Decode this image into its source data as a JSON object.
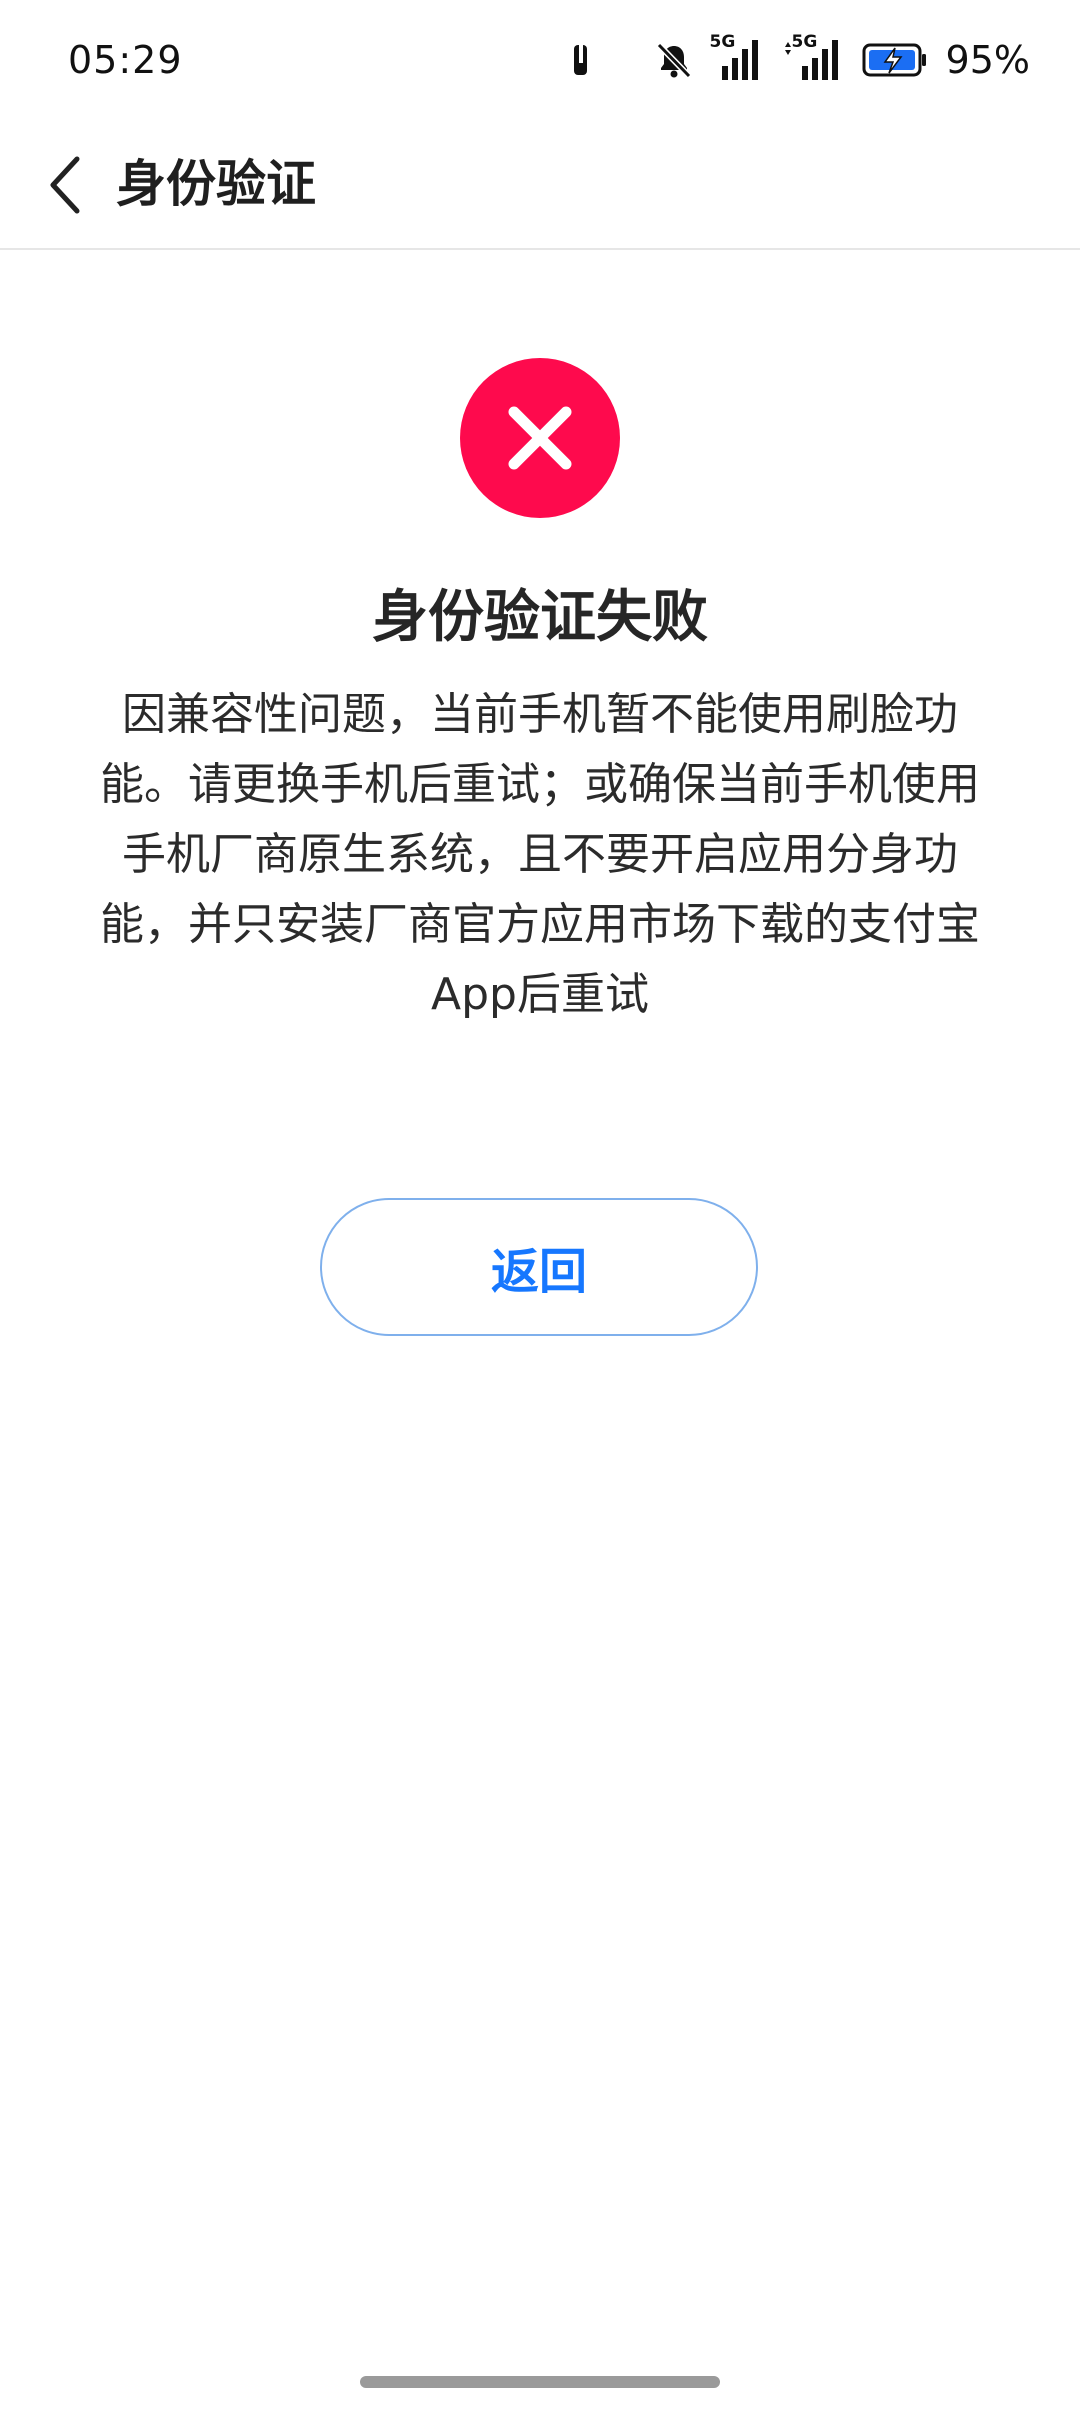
{
  "status_bar": {
    "time": "05:29",
    "network_1": "5G",
    "network_2": "5G",
    "battery_percent": "95%",
    "icons": [
      "notification-icon",
      "mute-icon",
      "signal-5g-icon",
      "signal-5g-icon",
      "battery-charging-icon"
    ]
  },
  "header": {
    "title": "身份验证",
    "back_icon": "chevron-left-icon"
  },
  "result": {
    "icon": "error-x-icon",
    "icon_color": "#fe0a4d",
    "title": "身份验证失败",
    "message": "因兼容性问题，当前手机暂不能使用刷脸功能。请更换手机后重试；或确保当前手机使用手机厂商原生系统，且不要开启应用分身功能，并只安装厂商官方应用市场下载的支付宝App后重试"
  },
  "actions": {
    "return_label": "返回",
    "return_color": "#1677ff"
  }
}
